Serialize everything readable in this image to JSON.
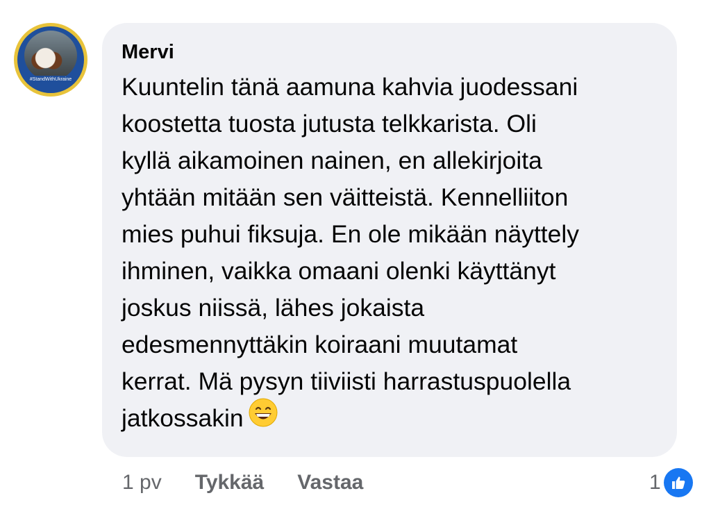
{
  "comment": {
    "author": "Mervi",
    "avatar_badge": "#StandWithUkraine",
    "text_lines": [
      "Kuuntelin tänä aamuna kahvia juodessani",
      "koostetta tuosta jutusta telkkarista. Oli",
      "kyllä aikamoinen nainen, en allekirjoita",
      "yhtään mitään sen väitteistä. Kennelliiton",
      "mies puhui fiksuja. En ole mikään näyttely",
      "ihminen, vaikka omaani olenki käyttänyt",
      "joskus niissä, lähes jokaista",
      "edesmennyttäkin koiraani muutamat",
      "kerrat. Mä pysyn tiiviisti harrastuspuolella",
      "jatkossakin"
    ],
    "emoji": "grinning-face-with-smiling-eyes"
  },
  "footer": {
    "time": "1 pv",
    "like_label": "Tykkää",
    "reply_label": "Vastaa"
  },
  "reactions": {
    "count": "1",
    "icon": "thumbs-up-icon",
    "color": "#1877f2"
  }
}
